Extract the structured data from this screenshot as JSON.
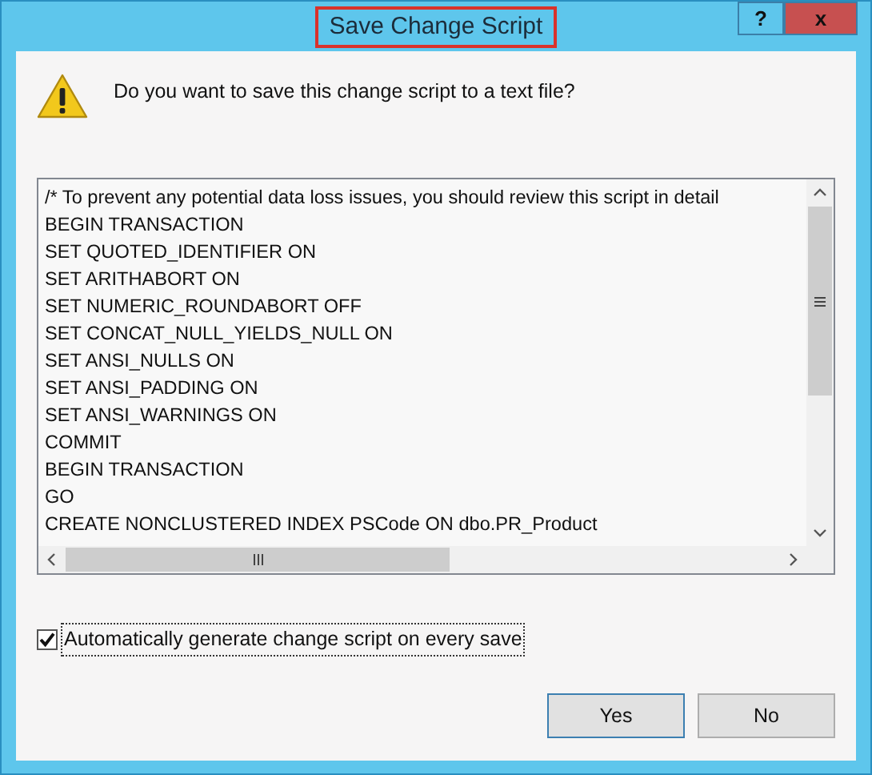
{
  "window": {
    "title": "Save Change Script",
    "title_highlighted": true
  },
  "message": "Do you want to save this change script to a text file?",
  "script_lines": [
    "/* To prevent any potential data loss issues, you should review this script in detail",
    "BEGIN TRANSACTION",
    "SET QUOTED_IDENTIFIER ON",
    "SET ARITHABORT ON",
    "SET NUMERIC_ROUNDABORT OFF",
    "SET CONCAT_NULL_YIELDS_NULL ON",
    "SET ANSI_NULLS ON",
    "SET ANSI_PADDING ON",
    "SET ANSI_WARNINGS ON",
    "COMMIT",
    "BEGIN TRANSACTION",
    "GO",
    "CREATE NONCLUSTERED INDEX PSCode ON dbo.PR_Product"
  ],
  "auto_generate": {
    "label": "Automatically generate change script on every save",
    "checked": true
  },
  "buttons": [
    {
      "label": "Yes",
      "default": true
    },
    {
      "label": "No",
      "default": false
    }
  ],
  "title_buttons": [
    "?",
    "x"
  ]
}
